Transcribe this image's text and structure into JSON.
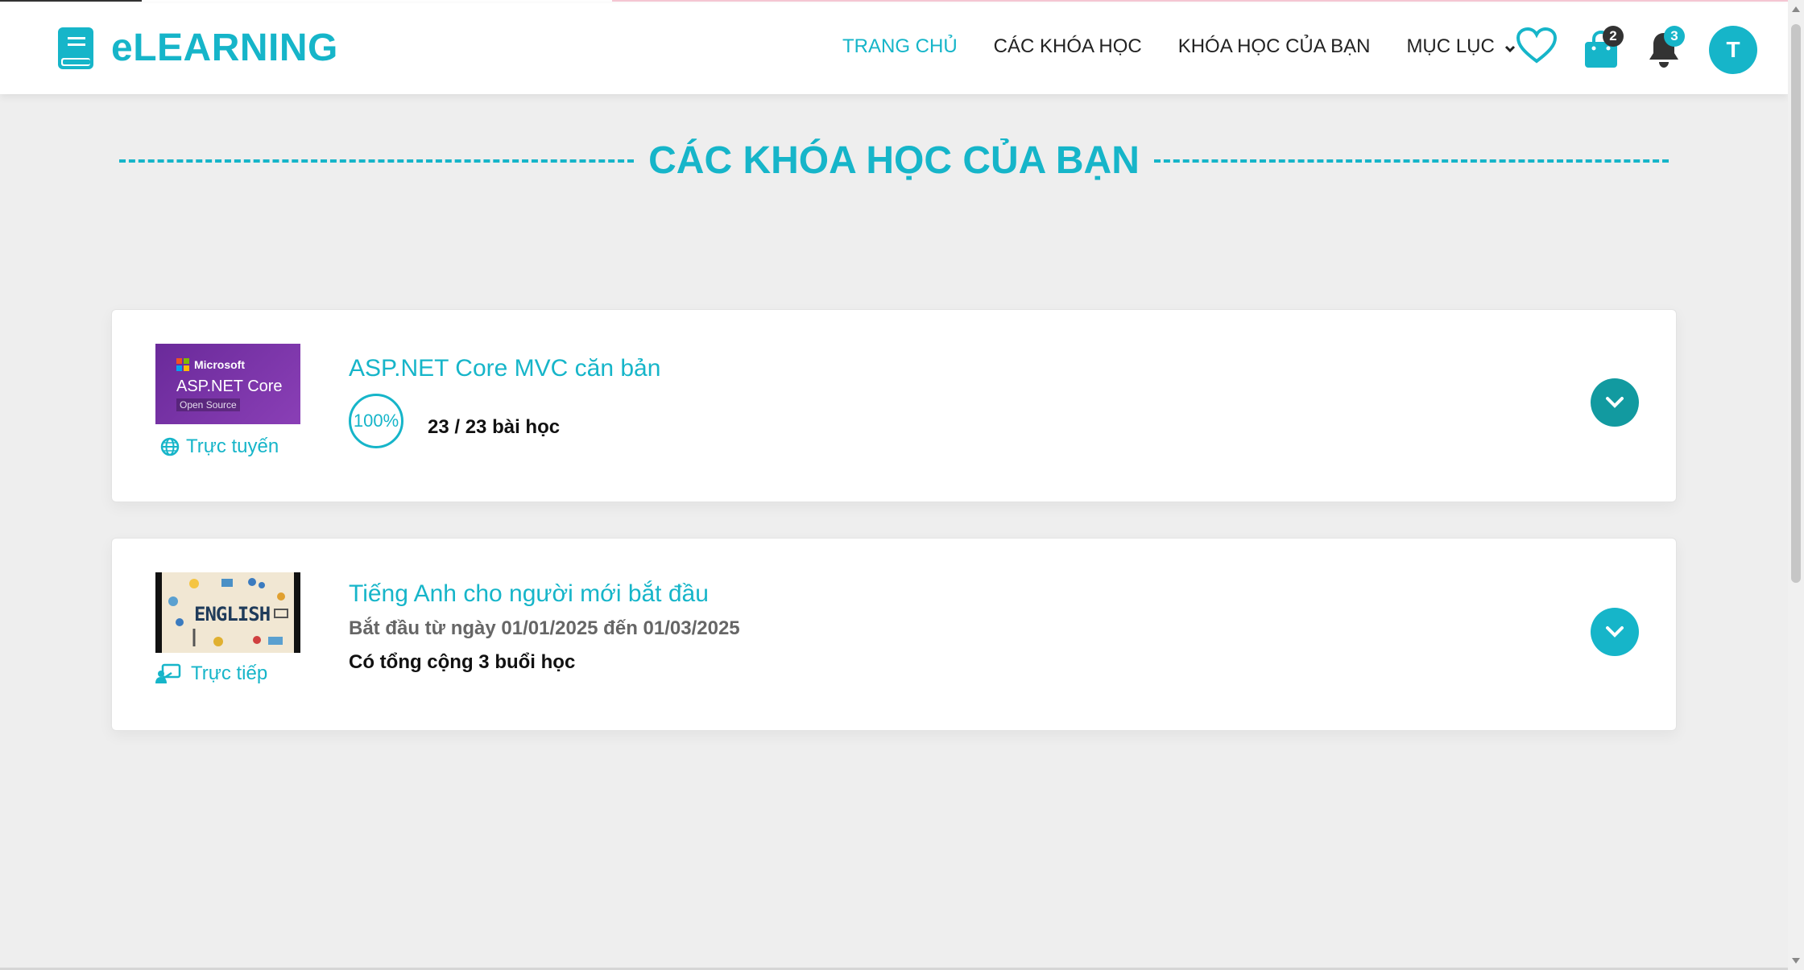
{
  "app": {
    "brand_name": "eLEARNING",
    "brand_icon": "book-icon",
    "accent_color": "#16b5c9"
  },
  "nav": {
    "items": [
      {
        "label": "TRANG CHỦ",
        "active": true
      },
      {
        "label": "CÁC KHÓA HỌC",
        "active": false
      },
      {
        "label": "KHÓA HỌC CỦA BẠN",
        "active": false
      },
      {
        "label": "MỤC LỤC",
        "active": false,
        "has_dropdown": true
      }
    ]
  },
  "header_icons": {
    "wishlist_icon": "heart-icon",
    "cart_icon": "shopping-bag-icon",
    "cart_count": "2",
    "notification_icon": "bell-icon",
    "notification_count": "3",
    "avatar_initial": "T"
  },
  "page": {
    "title": "CÁC KHÓA HỌC CỦA BẠN"
  },
  "courses": [
    {
      "title": "ASP.NET Core MVC căn bản",
      "mode": "Trực tuyến",
      "mode_icon": "globe-icon",
      "thumbnail": {
        "brand": "Microsoft",
        "product": "ASP.NET Core",
        "tagline": "Open Source"
      },
      "progress": "100%",
      "progress_value": 1.0,
      "lessons_count": "23 / 23",
      "lessons_suffix": "bài học"
    },
    {
      "title": "Tiếng Anh cho người mới bắt đầu",
      "mode": "Trực tiếp",
      "mode_icon": "classroom-icon",
      "thumbnail": {
        "word": "ENGLISH"
      },
      "dates": "Bắt đầu từ ngày 01/01/2025 đến 01/03/2025",
      "sessions": "Có tổng cộng 3 buổi học"
    }
  ]
}
